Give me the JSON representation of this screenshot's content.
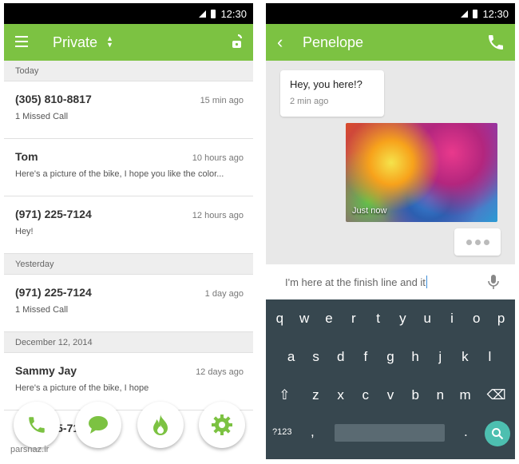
{
  "status": {
    "time": "12:30"
  },
  "left": {
    "header": {
      "title": "Private"
    },
    "list": [
      {
        "type": "section",
        "label": "Today"
      },
      {
        "type": "item",
        "name": "(305) 810-8817",
        "time": "15 min ago",
        "snippet": "1 Missed Call"
      },
      {
        "type": "item",
        "name": "Tom",
        "time": "10 hours ago",
        "snippet": "Here's a picture of the bike, I hope you like the color..."
      },
      {
        "type": "item",
        "name": "(971) 225-7124",
        "time": "12 hours ago",
        "snippet": "Hey!"
      },
      {
        "type": "section",
        "label": "Yesterday"
      },
      {
        "type": "item",
        "name": "(971) 225-7124",
        "time": "1 day ago",
        "snippet": "1 Missed Call"
      },
      {
        "type": "section",
        "label": "December 12, 2014"
      },
      {
        "type": "item",
        "name": "Sammy Jay",
        "time": "12 days ago",
        "snippet": "Here's a picture of the bike, I hope"
      },
      {
        "type": "item",
        "name": "(971) 225-7124",
        "time": "",
        "snippet": ""
      }
    ],
    "fabs": [
      "phone-icon",
      "chat-icon",
      "flame-icon",
      "gear-icon"
    ]
  },
  "right": {
    "header": {
      "title": "Penelope"
    },
    "incoming": {
      "text": "Hey, you here!?",
      "time": "2 min ago"
    },
    "photo": {
      "caption": "Just now"
    },
    "compose": {
      "text": "I'm here at the finish line and it"
    },
    "keyboard": {
      "row1": [
        "q",
        "w",
        "e",
        "r",
        "t",
        "y",
        "u",
        "i",
        "o",
        "p"
      ],
      "row2": [
        "a",
        "s",
        "d",
        "f",
        "g",
        "h",
        "j",
        "k",
        "l"
      ],
      "row3": [
        "z",
        "x",
        "c",
        "v",
        "b",
        "n",
        "m"
      ],
      "num_label": "?123",
      "comma": ",",
      "period": "."
    }
  },
  "watermark": "parsnaz.ir",
  "colors": {
    "accent": "#7cc242",
    "keyboard": "#37474f",
    "search_key": "#4dbfb0"
  }
}
